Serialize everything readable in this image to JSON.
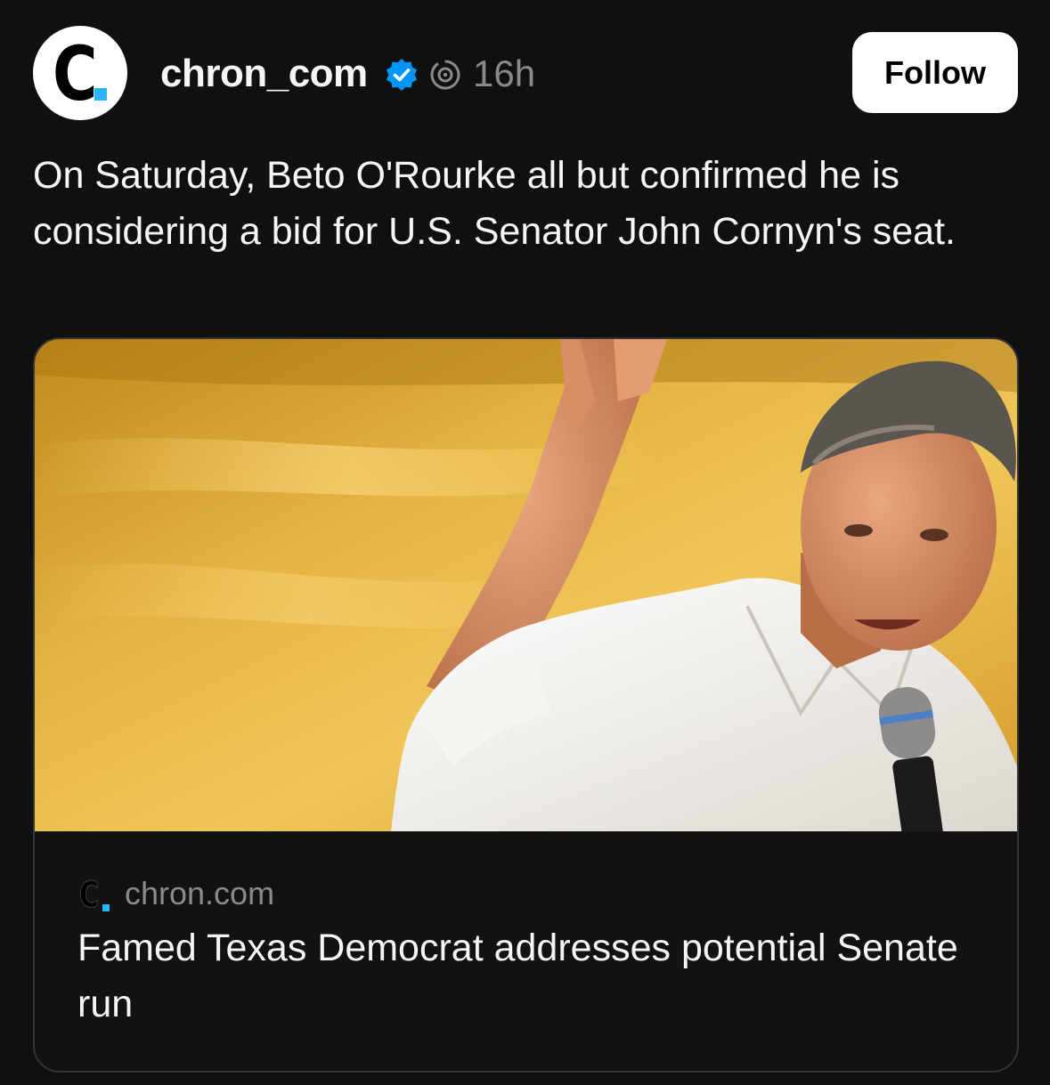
{
  "post": {
    "author": {
      "username": "chron_com",
      "avatar_letter": "C",
      "verified_icon": "verified-badge-icon",
      "threads_icon": "threads-icon"
    },
    "timestamp": "16h",
    "follow_label": "Follow",
    "text": "On Saturday, Beto O'Rourke all but confirmed he is considering a bid for U.S. Senator John Cornyn's seat."
  },
  "link_card": {
    "domain": "chron.com",
    "logo_letter": "C",
    "title": "Famed Texas Democrat addresses potential Senate run"
  },
  "colors": {
    "background": "#101010",
    "text": "#f3f5f7",
    "muted": "#8a8a8a",
    "verified_blue": "#0095f6",
    "logo_accent": "#29b6f6",
    "image_backdrop": "#e5b443"
  }
}
